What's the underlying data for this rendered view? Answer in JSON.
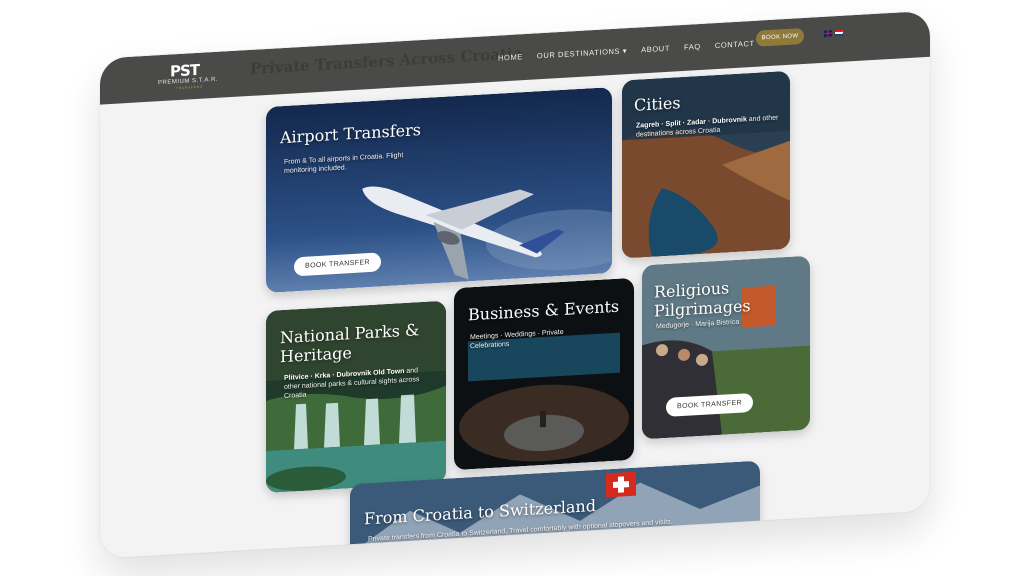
{
  "site": {
    "logo_mark": "PST",
    "logo_name": "PREMIUM S.T.A.R.",
    "logo_sub": "TRANSFERS",
    "ghost_title": "Private Transfers Across Croatia"
  },
  "nav": {
    "home": "HOME",
    "destinations": "OUR DESTINATIONS ▾",
    "about": "ABOUT",
    "faq": "FAQ",
    "contact": "CONTACT",
    "book_now": "BOOK NOW"
  },
  "cards": {
    "airport": {
      "title": "Airport Transfers",
      "desc": "From & To all airports in Croatia. Flight monitoring included.",
      "cta": "BOOK TRANSFER"
    },
    "cities": {
      "title": "Cities",
      "desc_bold": "Zagreb · Split · Zadar · Dubrovnik",
      "desc": " and other destinations across Croatia"
    },
    "parks": {
      "title": "National Parks & Heritage",
      "desc_bold": "Plitvice · Krka · Dubrovnik Old Town",
      "desc": " and other national parks & cultural sights across Croatia"
    },
    "business": {
      "title": "Business & Events",
      "desc": "Meetings · Weddings · Private Celebrations"
    },
    "religious": {
      "title": "Religious Pilgrimages",
      "desc": "Međugorje · Marija Bistrica",
      "cta": "BOOK TRANSFER"
    },
    "switzerland": {
      "title": "From Croatia to Switzerland",
      "desc": "Private transfers from Croatia to Switzerland. Travel comfortably with optional stopovers and visits."
    }
  },
  "colors": {
    "navbar": "#4a4a48",
    "accent_gold": "#8f7a3c",
    "page_bg": "#f3f3f4"
  }
}
